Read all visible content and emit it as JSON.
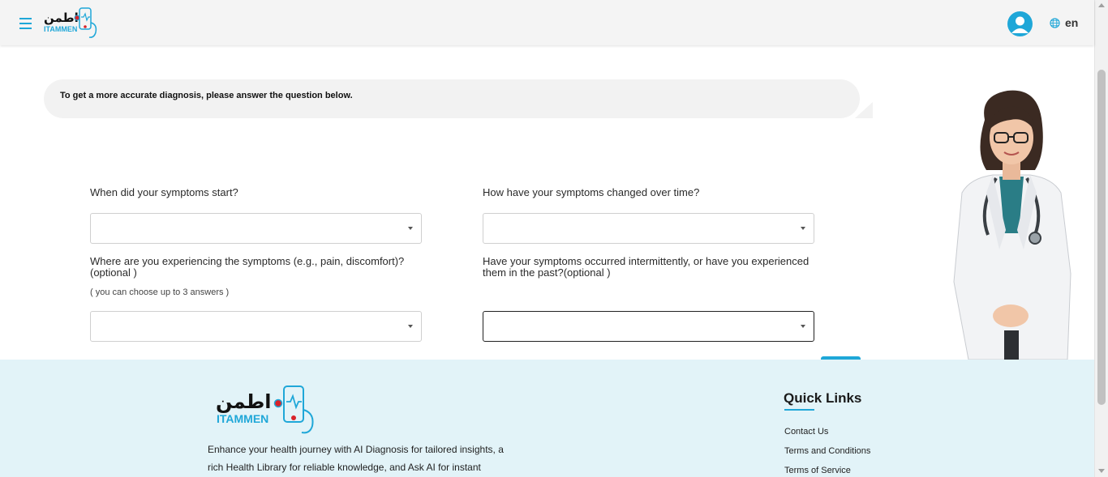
{
  "header": {
    "logo_arabic": "اطمن",
    "logo_latin": "ITAMMEN",
    "language": "en"
  },
  "bubble": {
    "text": "To get a more accurate diagnosis, please answer the question below."
  },
  "form": {
    "q1_label": "When did your symptoms start?",
    "q2_label": "How have your symptoms changed over time?",
    "q3_label": "Where are you experiencing the symptoms (e.g., pain, discomfort)?\n(optional )",
    "q3_hint": "( you can choose up to 3 answers )",
    "q4_label": "Have your symptoms occurred intermittently, or have you experienced them in the past?(optional )",
    "q1_value": "",
    "q2_value": "",
    "q3_value": "",
    "q4_value": ""
  },
  "footer": {
    "logo_arabic": "اطمن",
    "logo_latin": "ITAMMEN",
    "description": "Enhance your health journey with AI Diagnosis for tailored insights, a rich Health Library for reliable knowledge, and Ask AI for instant",
    "quick_links_title": "Quick Links",
    "links": [
      "Contact Us",
      "Terms and Conditions",
      "Terms of Service"
    ]
  },
  "colors": {
    "accent": "#1fa7d8",
    "footer_bg": "#e2f3f8",
    "logo_red": "#d8232a"
  }
}
